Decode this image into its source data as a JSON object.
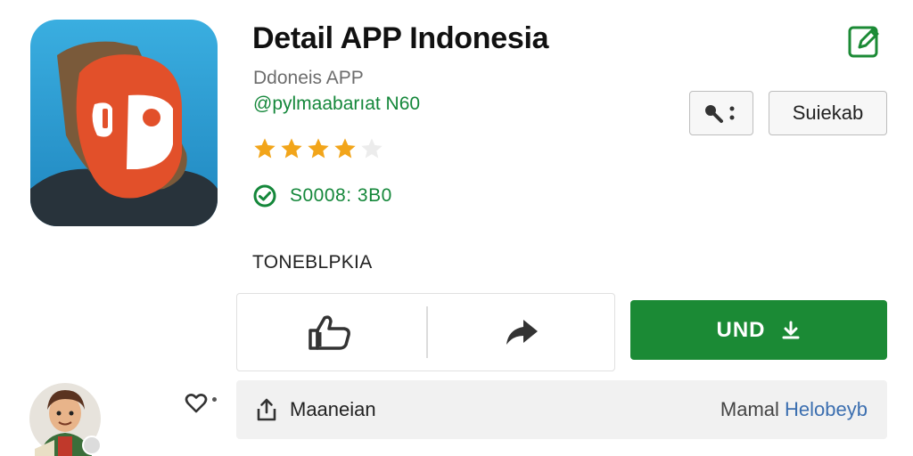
{
  "app": {
    "title": "Detail APP Indonesia",
    "publisher": "Ddoneis APP",
    "handle": "@pylmaabarıat  N60",
    "rating_stars": 4,
    "rating_max": 5,
    "status_text": "S0008: 3B0",
    "icon_name": "app-logo-mask"
  },
  "header": {
    "edit_icon": "edit-icon"
  },
  "buttons": {
    "key_icon": "key-icon",
    "subscribe_label": "Suiekab",
    "like_icon": "thumbs-up-icon",
    "share_icon": "share-icon",
    "install_label": "UND",
    "install_icon": "download-icon"
  },
  "section": {
    "label": "TONEBLPKIA"
  },
  "footer": {
    "share_label": "Maaneian",
    "right_muted": "Mamal",
    "right_link": "Helobeyb"
  },
  "colors": {
    "accent_green": "#1b8a35",
    "link_blue": "#3c6fb0",
    "star": "#f2a51a",
    "icon_bg": "#2ea4d5",
    "icon_mask": "#e2502a"
  }
}
